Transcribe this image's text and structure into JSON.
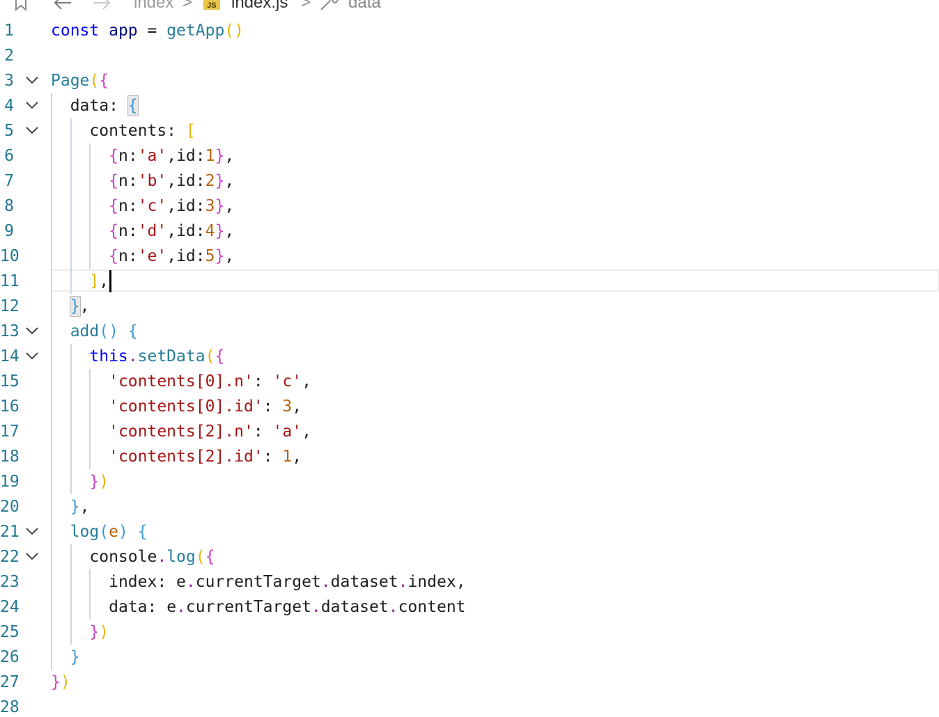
{
  "breadcrumb": {
    "folder": "index",
    "separator": ">",
    "file_icon_label": "JS",
    "file": "index.js",
    "symbol": "data"
  },
  "editor": {
    "lines": [
      {
        "num": "1",
        "fold": false
      },
      {
        "num": "2",
        "fold": false
      },
      {
        "num": "3",
        "fold": true
      },
      {
        "num": "4",
        "fold": true
      },
      {
        "num": "5",
        "fold": true
      },
      {
        "num": "6",
        "fold": false
      },
      {
        "num": "7",
        "fold": false
      },
      {
        "num": "8",
        "fold": false
      },
      {
        "num": "9",
        "fold": false
      },
      {
        "num": "10",
        "fold": false
      },
      {
        "num": "11",
        "fold": false
      },
      {
        "num": "12",
        "fold": false
      },
      {
        "num": "13",
        "fold": true
      },
      {
        "num": "14",
        "fold": true
      },
      {
        "num": "15",
        "fold": false
      },
      {
        "num": "16",
        "fold": false
      },
      {
        "num": "17",
        "fold": false
      },
      {
        "num": "18",
        "fold": false
      },
      {
        "num": "19",
        "fold": false
      },
      {
        "num": "20",
        "fold": false
      },
      {
        "num": "21",
        "fold": true
      },
      {
        "num": "22",
        "fold": true
      },
      {
        "num": "23",
        "fold": false
      },
      {
        "num": "24",
        "fold": false
      },
      {
        "num": "25",
        "fold": false
      },
      {
        "num": "26",
        "fold": false
      },
      {
        "num": "27",
        "fold": false
      },
      {
        "num": "28",
        "fold": false
      }
    ],
    "code": [
      [
        [
          "kw",
          "const"
        ],
        [
          "punct",
          " "
        ],
        [
          "var",
          "app"
        ],
        [
          "punct",
          " = "
        ],
        [
          "fnc",
          "getApp"
        ],
        [
          "b1",
          "()"
        ]
      ],
      [],
      [
        [
          "fnc",
          "Page"
        ],
        [
          "b1",
          "("
        ],
        [
          "b2",
          "{"
        ]
      ],
      [
        [
          "punct",
          "  "
        ],
        [
          "prop",
          "data"
        ],
        [
          "punct",
          ": "
        ],
        [
          "b3",
          "{"
        ]
      ],
      [
        [
          "punct",
          "    "
        ],
        [
          "prop",
          "contents"
        ],
        [
          "punct",
          ": "
        ],
        [
          "b1",
          "["
        ]
      ],
      [
        [
          "punct",
          "      "
        ],
        [
          "b2",
          "{"
        ],
        [
          "prop",
          "n"
        ],
        [
          "punct",
          ":"
        ],
        [
          "strk",
          "'a'"
        ],
        [
          "punct",
          ","
        ],
        [
          "prop",
          "id"
        ],
        [
          "punct",
          ":"
        ],
        [
          "param",
          "1"
        ],
        [
          "b2",
          "}"
        ],
        [
          "punct",
          ","
        ]
      ],
      [
        [
          "punct",
          "      "
        ],
        [
          "b2",
          "{"
        ],
        [
          "prop",
          "n"
        ],
        [
          "punct",
          ":"
        ],
        [
          "strk",
          "'b'"
        ],
        [
          "punct",
          ","
        ],
        [
          "prop",
          "id"
        ],
        [
          "punct",
          ":"
        ],
        [
          "param",
          "2"
        ],
        [
          "b2",
          "}"
        ],
        [
          "punct",
          ","
        ]
      ],
      [
        [
          "punct",
          "      "
        ],
        [
          "b2",
          "{"
        ],
        [
          "prop",
          "n"
        ],
        [
          "punct",
          ":"
        ],
        [
          "strk",
          "'c'"
        ],
        [
          "punct",
          ","
        ],
        [
          "prop",
          "id"
        ],
        [
          "punct",
          ":"
        ],
        [
          "param",
          "3"
        ],
        [
          "b2",
          "}"
        ],
        [
          "punct",
          ","
        ]
      ],
      [
        [
          "punct",
          "      "
        ],
        [
          "b2",
          "{"
        ],
        [
          "prop",
          "n"
        ],
        [
          "punct",
          ":"
        ],
        [
          "strk",
          "'d'"
        ],
        [
          "punct",
          ","
        ],
        [
          "prop",
          "id"
        ],
        [
          "punct",
          ":"
        ],
        [
          "param",
          "4"
        ],
        [
          "b2",
          "}"
        ],
        [
          "punct",
          ","
        ]
      ],
      [
        [
          "punct",
          "      "
        ],
        [
          "b2",
          "{"
        ],
        [
          "prop",
          "n"
        ],
        [
          "punct",
          ":"
        ],
        [
          "strk",
          "'e'"
        ],
        [
          "punct",
          ","
        ],
        [
          "prop",
          "id"
        ],
        [
          "punct",
          ":"
        ],
        [
          "param",
          "5"
        ],
        [
          "b2",
          "}"
        ],
        [
          "punct",
          ","
        ]
      ],
      [
        [
          "punct",
          "    "
        ],
        [
          "b1",
          "]"
        ],
        [
          "punct",
          ","
        ]
      ],
      [
        [
          "punct",
          "  "
        ],
        [
          "b3",
          "}"
        ],
        [
          "punct",
          ","
        ]
      ],
      [
        [
          "punct",
          "  "
        ],
        [
          "fnc",
          "add"
        ],
        [
          "b3",
          "()"
        ],
        [
          "punct",
          " "
        ],
        [
          "b3",
          "{"
        ]
      ],
      [
        [
          "punct",
          "    "
        ],
        [
          "this",
          "this"
        ],
        [
          "dot",
          "."
        ],
        [
          "fnc",
          "setData"
        ],
        [
          "b1",
          "("
        ],
        [
          "b2",
          "{"
        ]
      ],
      [
        [
          "punct",
          "      "
        ],
        [
          "strk",
          "'contents[0].n'"
        ],
        [
          "punct",
          ": "
        ],
        [
          "strk",
          "'c'"
        ],
        [
          "punct",
          ","
        ]
      ],
      [
        [
          "punct",
          "      "
        ],
        [
          "strk",
          "'contents[0].id'"
        ],
        [
          "punct",
          ": "
        ],
        [
          "param",
          "3"
        ],
        [
          "punct",
          ","
        ]
      ],
      [
        [
          "punct",
          "      "
        ],
        [
          "strk",
          "'contents[2].n'"
        ],
        [
          "punct",
          ": "
        ],
        [
          "strk",
          "'a'"
        ],
        [
          "punct",
          ","
        ]
      ],
      [
        [
          "punct",
          "      "
        ],
        [
          "strk",
          "'contents[2].id'"
        ],
        [
          "punct",
          ": "
        ],
        [
          "param",
          "1"
        ],
        [
          "punct",
          ","
        ]
      ],
      [
        [
          "punct",
          "    "
        ],
        [
          "b2",
          "}"
        ],
        [
          "b1",
          ")"
        ]
      ],
      [
        [
          "punct",
          "  "
        ],
        [
          "b3",
          "}"
        ],
        [
          "punct",
          ","
        ]
      ],
      [
        [
          "punct",
          "  "
        ],
        [
          "fnc",
          "log"
        ],
        [
          "b3",
          "("
        ],
        [
          "param",
          "e"
        ],
        [
          "b3",
          ")"
        ],
        [
          "punct",
          " "
        ],
        [
          "b3",
          "{"
        ]
      ],
      [
        [
          "punct",
          "    "
        ],
        [
          "prop",
          "console"
        ],
        [
          "dot",
          "."
        ],
        [
          "fnc",
          "log"
        ],
        [
          "b1",
          "("
        ],
        [
          "b2",
          "{"
        ]
      ],
      [
        [
          "punct",
          "      "
        ],
        [
          "prop",
          "index"
        ],
        [
          "punct",
          ": "
        ],
        [
          "prop",
          "e"
        ],
        [
          "dot",
          "."
        ],
        [
          "prop",
          "currentTarget"
        ],
        [
          "dot",
          "."
        ],
        [
          "prop",
          "dataset"
        ],
        [
          "dot",
          "."
        ],
        [
          "prop",
          "index"
        ],
        [
          "punct",
          ","
        ]
      ],
      [
        [
          "punct",
          "      "
        ],
        [
          "prop",
          "data"
        ],
        [
          "punct",
          ": "
        ],
        [
          "prop",
          "e"
        ],
        [
          "dot",
          "."
        ],
        [
          "prop",
          "currentTarget"
        ],
        [
          "dot",
          "."
        ],
        [
          "prop",
          "dataset"
        ],
        [
          "dot",
          "."
        ],
        [
          "prop",
          "content"
        ]
      ],
      [
        [
          "punct",
          "    "
        ],
        [
          "b2",
          "}"
        ],
        [
          "b1",
          ")"
        ]
      ],
      [
        [
          "punct",
          "  "
        ],
        [
          "b3",
          "}"
        ]
      ],
      [
        [
          "b2",
          "}"
        ],
        [
          "b1",
          ")"
        ]
      ],
      []
    ]
  }
}
